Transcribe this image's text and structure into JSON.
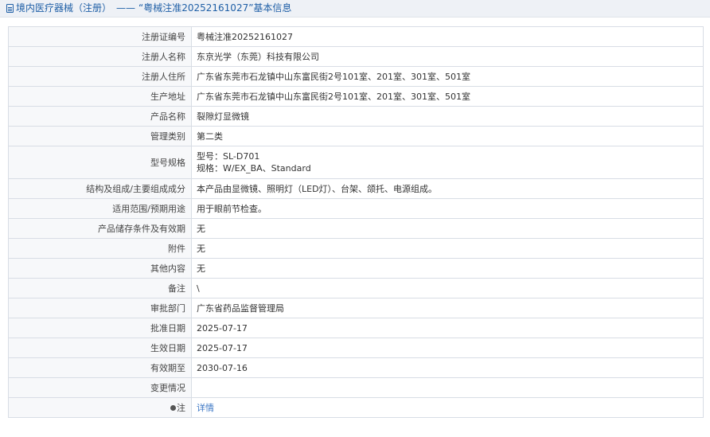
{
  "header": {
    "category": "境内医疗器械（注册）",
    "separator": "——",
    "title": "“粤械注准20252161027”基本信息"
  },
  "rows": [
    {
      "label": "注册证编号",
      "value": "粤械注准20252161027"
    },
    {
      "label": "注册人名称",
      "value": "东京光学（东莞）科技有限公司"
    },
    {
      "label": "注册人住所",
      "value": "广东省东莞市石龙镇中山东富民街2号101室、201室、301室、501室"
    },
    {
      "label": "生产地址",
      "value": "广东省东莞市石龙镇中山东富民街2号101室、201室、301室、501室"
    },
    {
      "label": "产品名称",
      "value": "裂隙灯显微镜"
    },
    {
      "label": "管理类别",
      "value": "第二类"
    },
    {
      "label": "型号规格",
      "value_lines": [
        "型号：SL-D701",
        "规格：W/EX_BA、Standard"
      ]
    },
    {
      "label": "结构及组成/主要组成成分",
      "value": "本产品由显微镜、照明灯（LED灯）、台架、颌托、电源组成。"
    },
    {
      "label": "适用范围/预期用途",
      "value": "用于眼前节检查。"
    },
    {
      "label": "产品储存条件及有效期",
      "value": "无"
    },
    {
      "label": "附件",
      "value": "无"
    },
    {
      "label": "其他内容",
      "value": "无"
    },
    {
      "label": "备注",
      "value": "\\"
    },
    {
      "label": "审批部门",
      "value": "广东省药品监督管理局"
    },
    {
      "label": "批准日期",
      "value": "2025-07-17"
    },
    {
      "label": "生效日期",
      "value": "2025-07-17"
    },
    {
      "label": "有效期至",
      "value": "2030-07-16"
    },
    {
      "label": "变更情况",
      "value": ""
    },
    {
      "label": "注",
      "value": "详情",
      "icon": "note-dot-icon"
    }
  ]
}
